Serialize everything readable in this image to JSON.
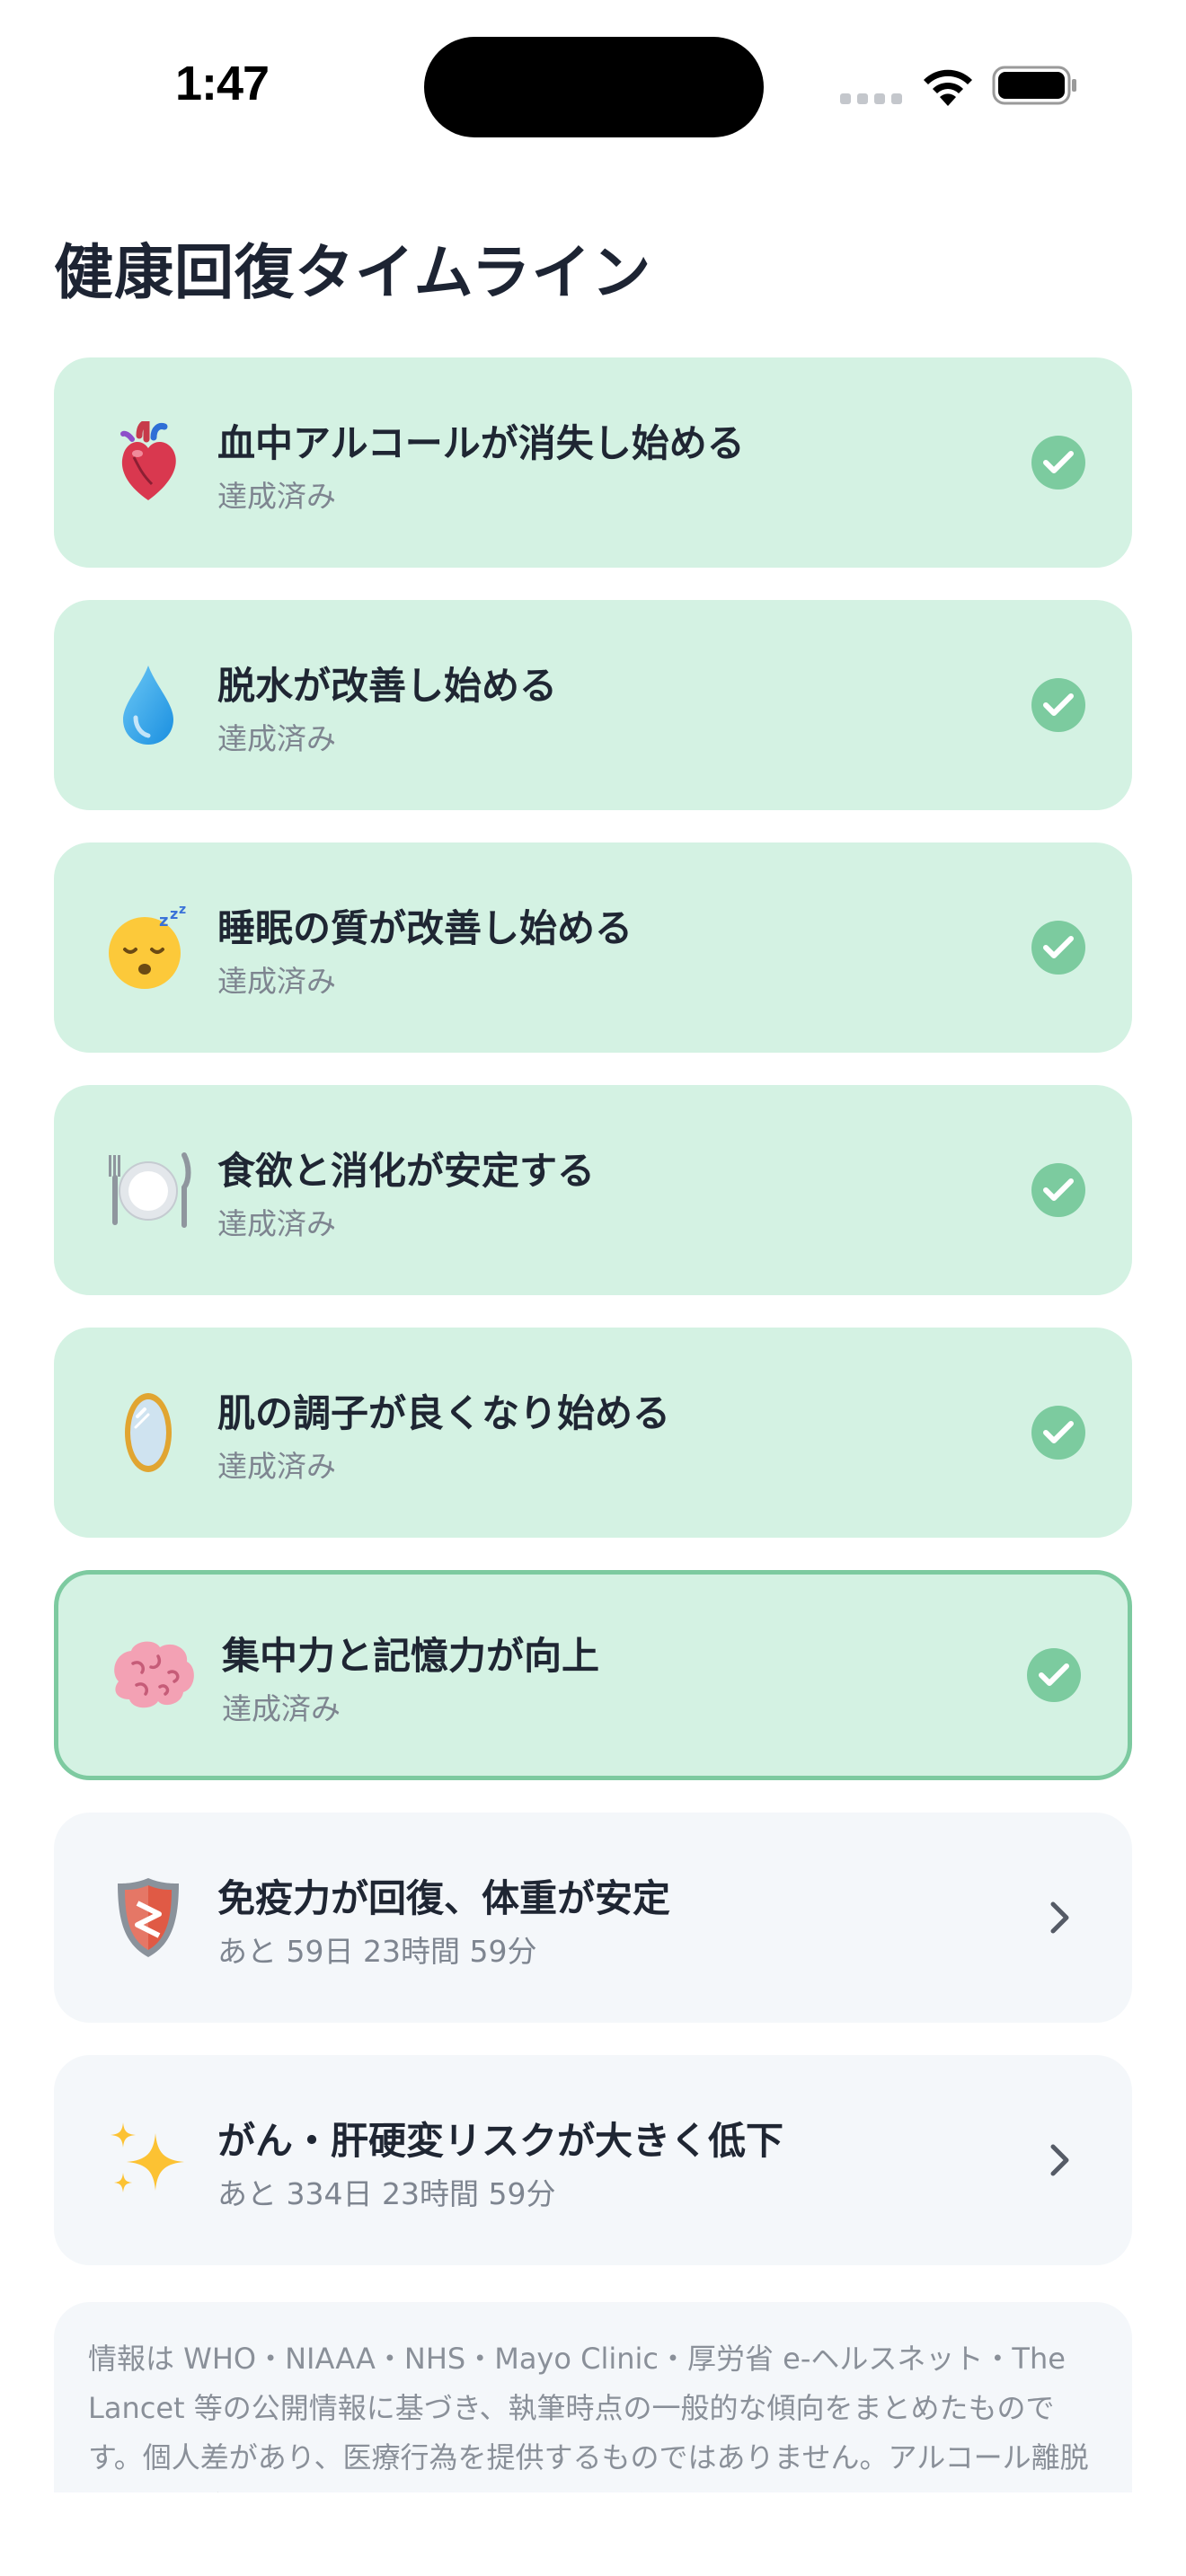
{
  "status_bar": {
    "time": "1:47"
  },
  "page_title": "健康回復タイムライン",
  "milestones": [
    {
      "title": "血中アルコールが消失し始める",
      "subtitle": "達成済み",
      "icon": "anatomical-heart-icon"
    },
    {
      "title": "脱水が改善し始める",
      "subtitle": "達成済み",
      "icon": "droplet-icon"
    },
    {
      "title": "睡眠の質が改善し始める",
      "subtitle": "達成済み",
      "icon": "sleeping-face-icon"
    },
    {
      "title": "食欲と消化が安定する",
      "subtitle": "達成済み",
      "icon": "plate-cutlery-icon"
    },
    {
      "title": "肌の調子が良くなり始める",
      "subtitle": "達成済み",
      "icon": "mirror-icon"
    },
    {
      "title": "集中力と記憶力が向上",
      "subtitle": "達成済み",
      "icon": "brain-icon"
    },
    {
      "title": "免疫力が回復、体重が安定",
      "subtitle": "あと 59日 23時間 59分",
      "icon": "shield-icon"
    },
    {
      "title": "がん・肝硬変リスクが大きく低下",
      "subtitle": "あと 334日 23時間 59分",
      "icon": "sparkles-icon"
    }
  ],
  "disclaimer": "情報は WHO・NIAAA・NHS・Mayo Clinic・厚労省 e-ヘルスネット・The Lancet 等の公開情報に基づき、執筆時点の一般的な傾向をまとめたものです。個人差があり、医療行為を提供するものではありません。アルコール離脱症状は生命に関わることがあるため、大量飲酒者の急な断酒は",
  "colors": {
    "achieved_bg": "#d4f2e3",
    "current_border": "#7dcaa0",
    "pending_bg": "#f4f7fa",
    "check": "#7ccb9f",
    "title_text": "#1f2633",
    "sub_text": "#7e8590"
  }
}
